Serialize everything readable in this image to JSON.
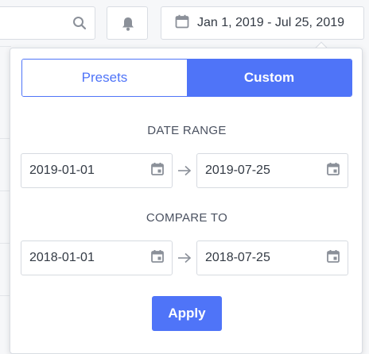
{
  "header": {
    "date_range_label": "Jan 1, 2019 - Jul 25, 2019",
    "icons": {
      "search": "search-icon",
      "bell": "bell-icon",
      "calendar": "calendar-icon"
    }
  },
  "picker": {
    "tabs": [
      {
        "label": "Presets",
        "active": false
      },
      {
        "label": "Custom",
        "active": true
      }
    ],
    "date_range": {
      "label": "DATE RANGE",
      "start": "2019-01-01",
      "end": "2019-07-25"
    },
    "compare_to": {
      "label": "COMPARE TO",
      "start": "2018-01-01",
      "end": "2018-07-25"
    },
    "apply_label": "Apply"
  },
  "colors": {
    "accent": "#4f74f8",
    "border": "#d9dde3",
    "icon": "#8b9099"
  }
}
